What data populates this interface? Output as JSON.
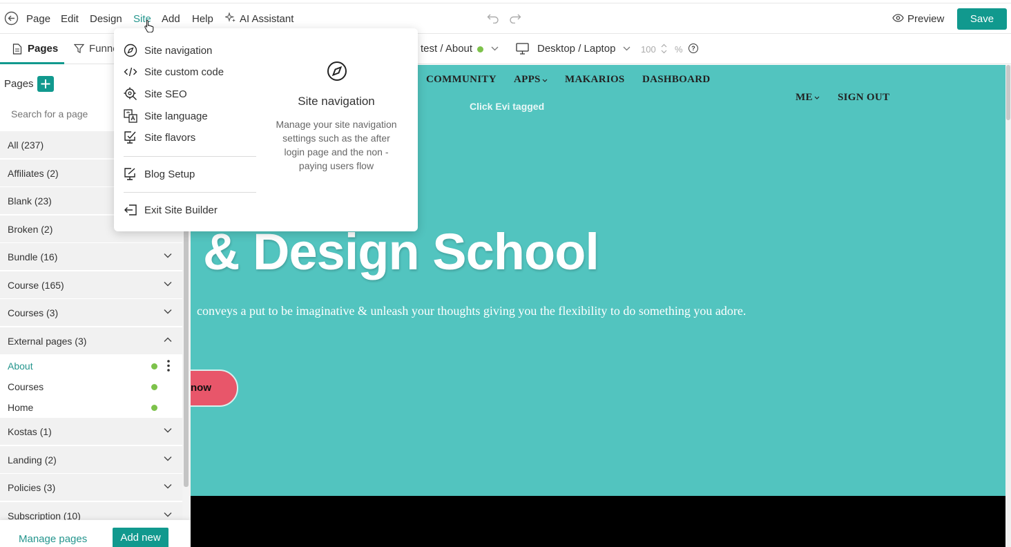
{
  "topbar": {
    "menu": [
      "Page",
      "Edit",
      "Design",
      "Site",
      "Add",
      "Help"
    ],
    "ai_assistant": "AI Assistant",
    "preview": "Preview",
    "save": "Save"
  },
  "subbar": {
    "tabs": [
      "Pages",
      "Funne"
    ],
    "page_selector": "test / About",
    "device": "Desktop / Laptop",
    "zoom": "100",
    "zoom_unit": "%",
    "help": "?"
  },
  "sidebar": {
    "title": "Pages",
    "search_placeholder": "Search for a page",
    "categories": [
      "All (237)",
      "Affiliates (2)",
      "Blank (23)",
      "Broken (2)",
      "Bundle (16)",
      "Course (165)",
      "Courses (3)",
      "External pages (3)"
    ],
    "external_pages": [
      "About",
      "Courses",
      "Home"
    ],
    "categories_after": [
      "Kostas (1)",
      "Landing (2)",
      "Policies (3)",
      "Subscription (10)"
    ],
    "manage_pages": "Manage pages",
    "add_new": "Add new"
  },
  "dropdown": {
    "items": [
      "Site navigation",
      "Site custom code",
      "Site SEO",
      "Site language",
      "Site flavors"
    ],
    "blog": "Blog Setup",
    "exit": "Exit Site Builder",
    "detail_title": "Site navigation",
    "detail_desc": "Manage your site navigation settings such as the after login page and the non - paying users flow"
  },
  "canvas": {
    "nav": [
      "COMMUNITY",
      "APPS",
      "MAKARIOS",
      "DASHBOARD"
    ],
    "nav_right": [
      "ME",
      "SIGN OUT"
    ],
    "tagged": "Click Evi tagged",
    "headline": "& Design School",
    "subline": "conveys a put to be imaginative & unleash your thoughts giving you the flexibility to do something you adore.",
    "cta": "now"
  },
  "colors": {
    "accent": "#11998e",
    "canvas_bg": "#52c4bf",
    "cta_bg": "#e8566a",
    "status_green": "#7dc24b"
  }
}
